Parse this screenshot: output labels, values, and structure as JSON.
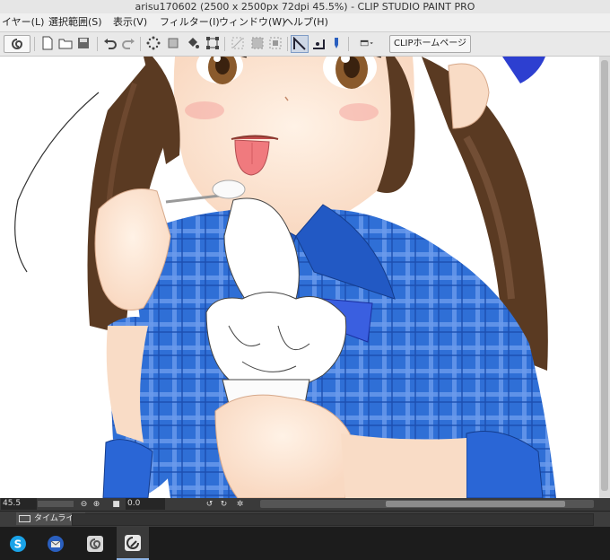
{
  "window": {
    "title": "arisu170602 (2500 x 2500px 72dpi 45.5%) - CLIP STUDIO PAINT PRO"
  },
  "menu": {
    "items": [
      {
        "label": "イヤー(L)"
      },
      {
        "label": "選択範囲(S)"
      },
      {
        "label": "表示(V)"
      },
      {
        "label": "フィルター(I)"
      },
      {
        "label": "ウィンドウ(W)"
      },
      {
        "label": "ヘルプ(H)"
      }
    ]
  },
  "toolbar": {
    "home_label": "CLIPホームページ"
  },
  "status": {
    "zoom": "45.5",
    "angle": "0.0"
  },
  "timeline": {
    "tab_label": "タイムライン"
  },
  "taskbar": {
    "apps": [
      "skype",
      "thunderbird",
      "clip-studio",
      "clip-studio-paint"
    ]
  },
  "colors": {
    "shirt": "#2f6fd6",
    "hair": "#5a3a22",
    "taskbar": "#1c1c1c",
    "accent": "#8fb5e6"
  }
}
